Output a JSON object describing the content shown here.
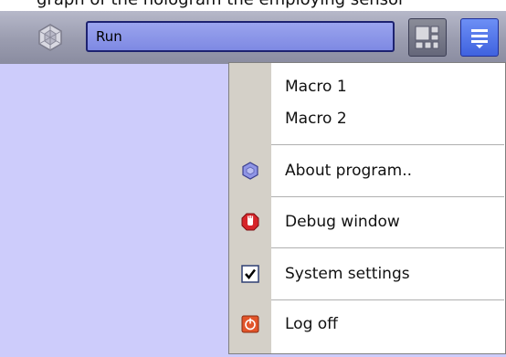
{
  "caption": "graph of the hologram the employing sensor",
  "toolbar": {
    "run_value": "Run",
    "logo_icon": "hexagon-logo-icon",
    "layout_icon": "grid-layout-icon",
    "menu_icon": "hamburger-menu-icon"
  },
  "menu": {
    "items": [
      {
        "label": "Macro 1",
        "icon": null
      },
      {
        "label": "Macro 2",
        "icon": null
      },
      {
        "label": "About program..",
        "icon": "about-hexagon-icon"
      },
      {
        "label": "Debug window",
        "icon": "debug-stop-hand-icon"
      },
      {
        "label": "System settings",
        "icon": "checkbox-checked-icon"
      },
      {
        "label": "Log off",
        "icon": "power-icon"
      }
    ]
  },
  "colors": {
    "accent": "#4f6fe8",
    "background": "#cdccfb",
    "field": "#8f98ea"
  }
}
